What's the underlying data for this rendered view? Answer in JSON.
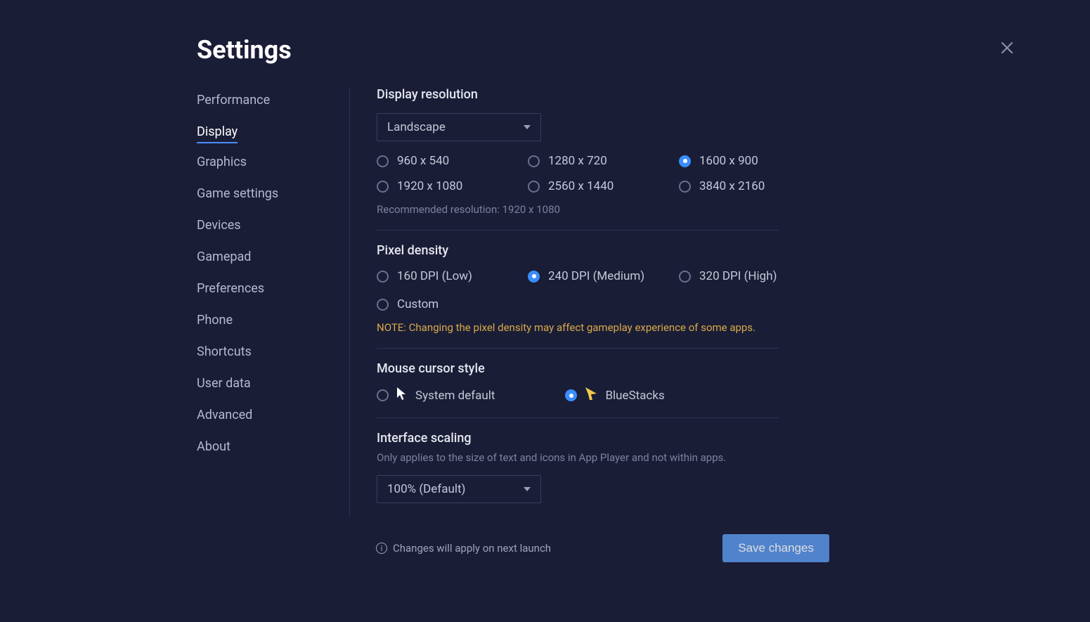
{
  "title": "Settings",
  "sidebar": {
    "items": [
      {
        "label": "Performance"
      },
      {
        "label": "Display",
        "active": true
      },
      {
        "label": "Graphics"
      },
      {
        "label": "Game settings"
      },
      {
        "label": "Devices"
      },
      {
        "label": "Gamepad"
      },
      {
        "label": "Preferences"
      },
      {
        "label": "Phone"
      },
      {
        "label": "Shortcuts"
      },
      {
        "label": "User data"
      },
      {
        "label": "Advanced"
      },
      {
        "label": "About"
      }
    ]
  },
  "display": {
    "resolution_title": "Display resolution",
    "orientation_selected": "Landscape",
    "resolutions": [
      {
        "label": "960 x 540"
      },
      {
        "label": "1280 x 720"
      },
      {
        "label": "1600 x 900",
        "checked": true
      },
      {
        "label": "1920 x 1080"
      },
      {
        "label": "2560 x 1440"
      },
      {
        "label": "3840 x 2160"
      }
    ],
    "recommended": "Recommended resolution: 1920 x 1080",
    "density_title": "Pixel density",
    "densities": [
      {
        "label": "160 DPI (Low)"
      },
      {
        "label": "240 DPI (Medium)",
        "checked": true
      },
      {
        "label": "320 DPI (High)"
      },
      {
        "label": "Custom"
      }
    ],
    "density_note": "NOTE: Changing the pixel density may affect gameplay experience of some apps.",
    "cursor_title": "Mouse cursor style",
    "cursor_options": [
      {
        "label": "System default"
      },
      {
        "label": "BlueStacks",
        "checked": true
      }
    ],
    "scaling_title": "Interface scaling",
    "scaling_subtitle": "Only applies to the size of text and icons in App Player and not within apps.",
    "scaling_selected": "100% (Default)"
  },
  "footer": {
    "note": "Changes will apply on next launch",
    "save": "Save changes"
  }
}
